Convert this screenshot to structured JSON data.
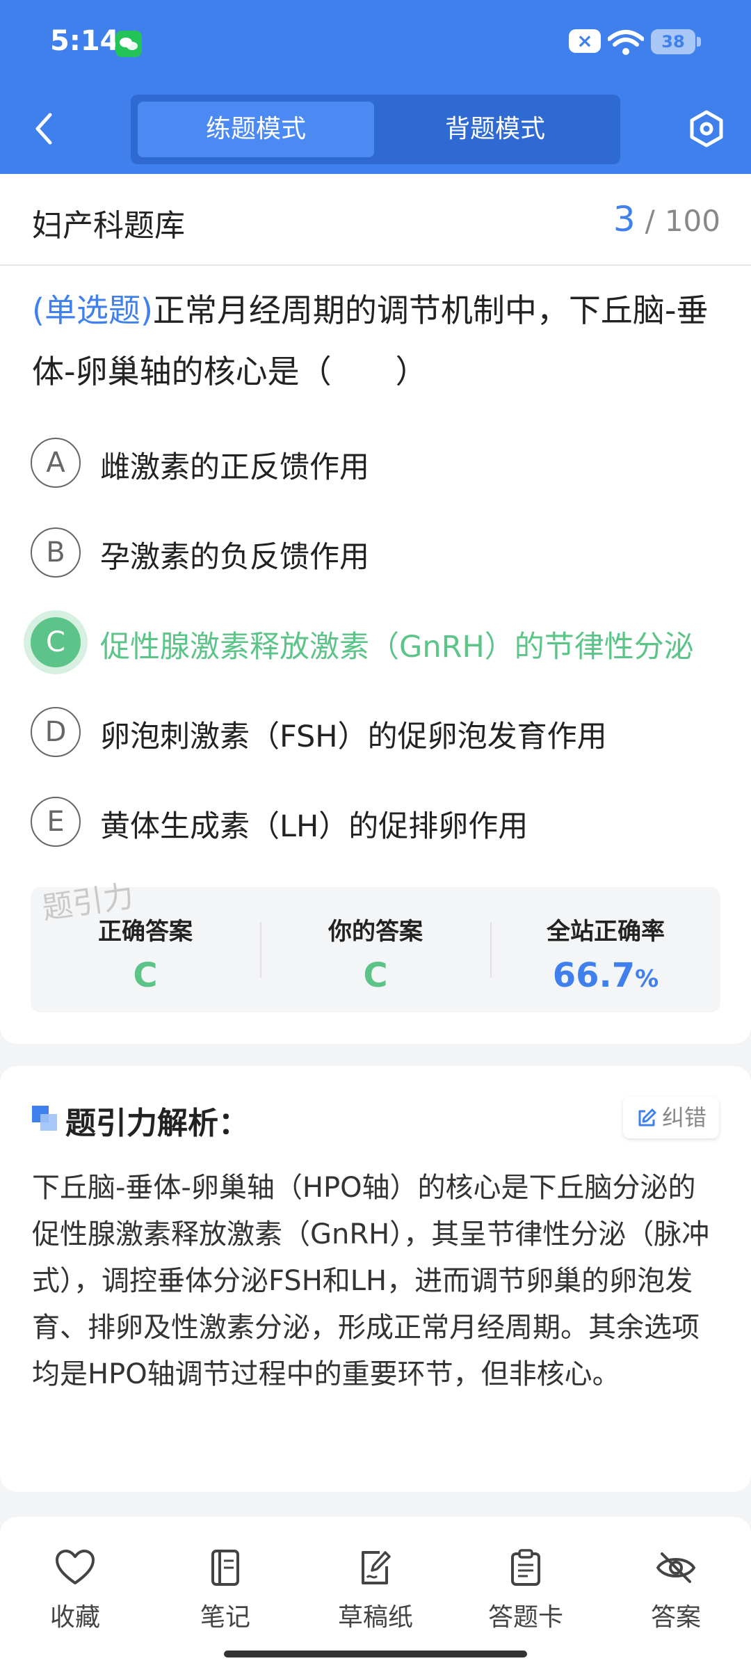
{
  "status_bar": {
    "time": "5:14",
    "battery": "38"
  },
  "header": {
    "modes": [
      {
        "label": "练题模式",
        "active": true
      },
      {
        "label": "背题模式",
        "active": false
      }
    ]
  },
  "bank": {
    "name": "妇产科题库",
    "current": "3",
    "separator": "/",
    "total": "100"
  },
  "question": {
    "type": "(单选题)",
    "text": "正常月经周期的调节机制中，下丘脑-垂体-卵巢轴的核心是（　　）"
  },
  "options": [
    {
      "letter": "A",
      "text": "雌激素的正反馈作用"
    },
    {
      "letter": "B",
      "text": "孕激素的负反馈作用"
    },
    {
      "letter": "C",
      "text": "促性腺激素释放激素（GnRH）的节律性分泌"
    },
    {
      "letter": "D",
      "text": "卵泡刺激素（FSH）的促卵泡发育作用"
    },
    {
      "letter": "E",
      "text": "黄体生成素（LH）的促排卵作用"
    }
  ],
  "watermark": "题引力",
  "stats": {
    "correct_label": "正确答案",
    "correct_value": "C",
    "yours_label": "你的答案",
    "yours_value": "C",
    "rate_label": "全站正确率",
    "rate_value": "66.7",
    "rate_unit": "%"
  },
  "analysis": {
    "title": "题引力解析：",
    "fix_label": "纠错",
    "body": "下丘脑-垂体-卵巢轴（HPO轴）的核心是下丘脑分泌的促性腺激素释放激素（GnRH），其呈节律性分泌（脉冲式），调控垂体分泌FSH和LH，进而调节卵巢的卵泡发育、排卵及性激素分泌，形成正常月经周期。其余选项均是HPO轴调节过程中的重要环节，但非核心。"
  },
  "bottom_nav": [
    {
      "label": "收藏",
      "icon": "heart-icon"
    },
    {
      "label": "笔记",
      "icon": "notebook-icon"
    },
    {
      "label": "草稿纸",
      "icon": "draft-icon"
    },
    {
      "label": "答题卡",
      "icon": "clipboard-icon"
    },
    {
      "label": "答案",
      "icon": "eye-off-icon"
    }
  ],
  "colors": {
    "brand": "#3f80ec",
    "correct": "#5cc488"
  }
}
